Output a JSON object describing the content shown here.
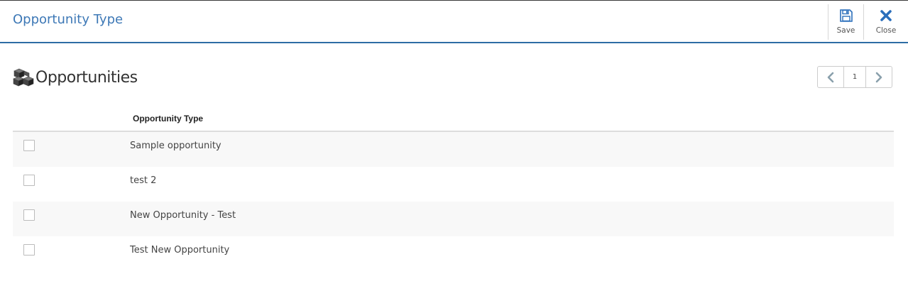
{
  "header": {
    "title": "Opportunity Type",
    "actions": {
      "save_label": "Save",
      "close_label": "Close"
    }
  },
  "section": {
    "title": "Opportunities",
    "icon": "cubes-icon"
  },
  "pager": {
    "current_page": "1",
    "prev_icon": "chevron-left-icon",
    "next_icon": "chevron-right-icon"
  },
  "table": {
    "columns": [
      "Opportunity Type"
    ],
    "rows": [
      {
        "opportunity_type": "Sample opportunity",
        "checked": false
      },
      {
        "opportunity_type": "test 2",
        "checked": false
      },
      {
        "opportunity_type": "New Opportunity - Test",
        "checked": false
      },
      {
        "opportunity_type": "Test New Opportunity",
        "checked": false
      }
    ]
  },
  "colors": {
    "accent": "#3d78b6",
    "header_border": "#2e6da4",
    "row_stripe": "#f8f8f8",
    "close_icon": "#2a6ebb"
  }
}
